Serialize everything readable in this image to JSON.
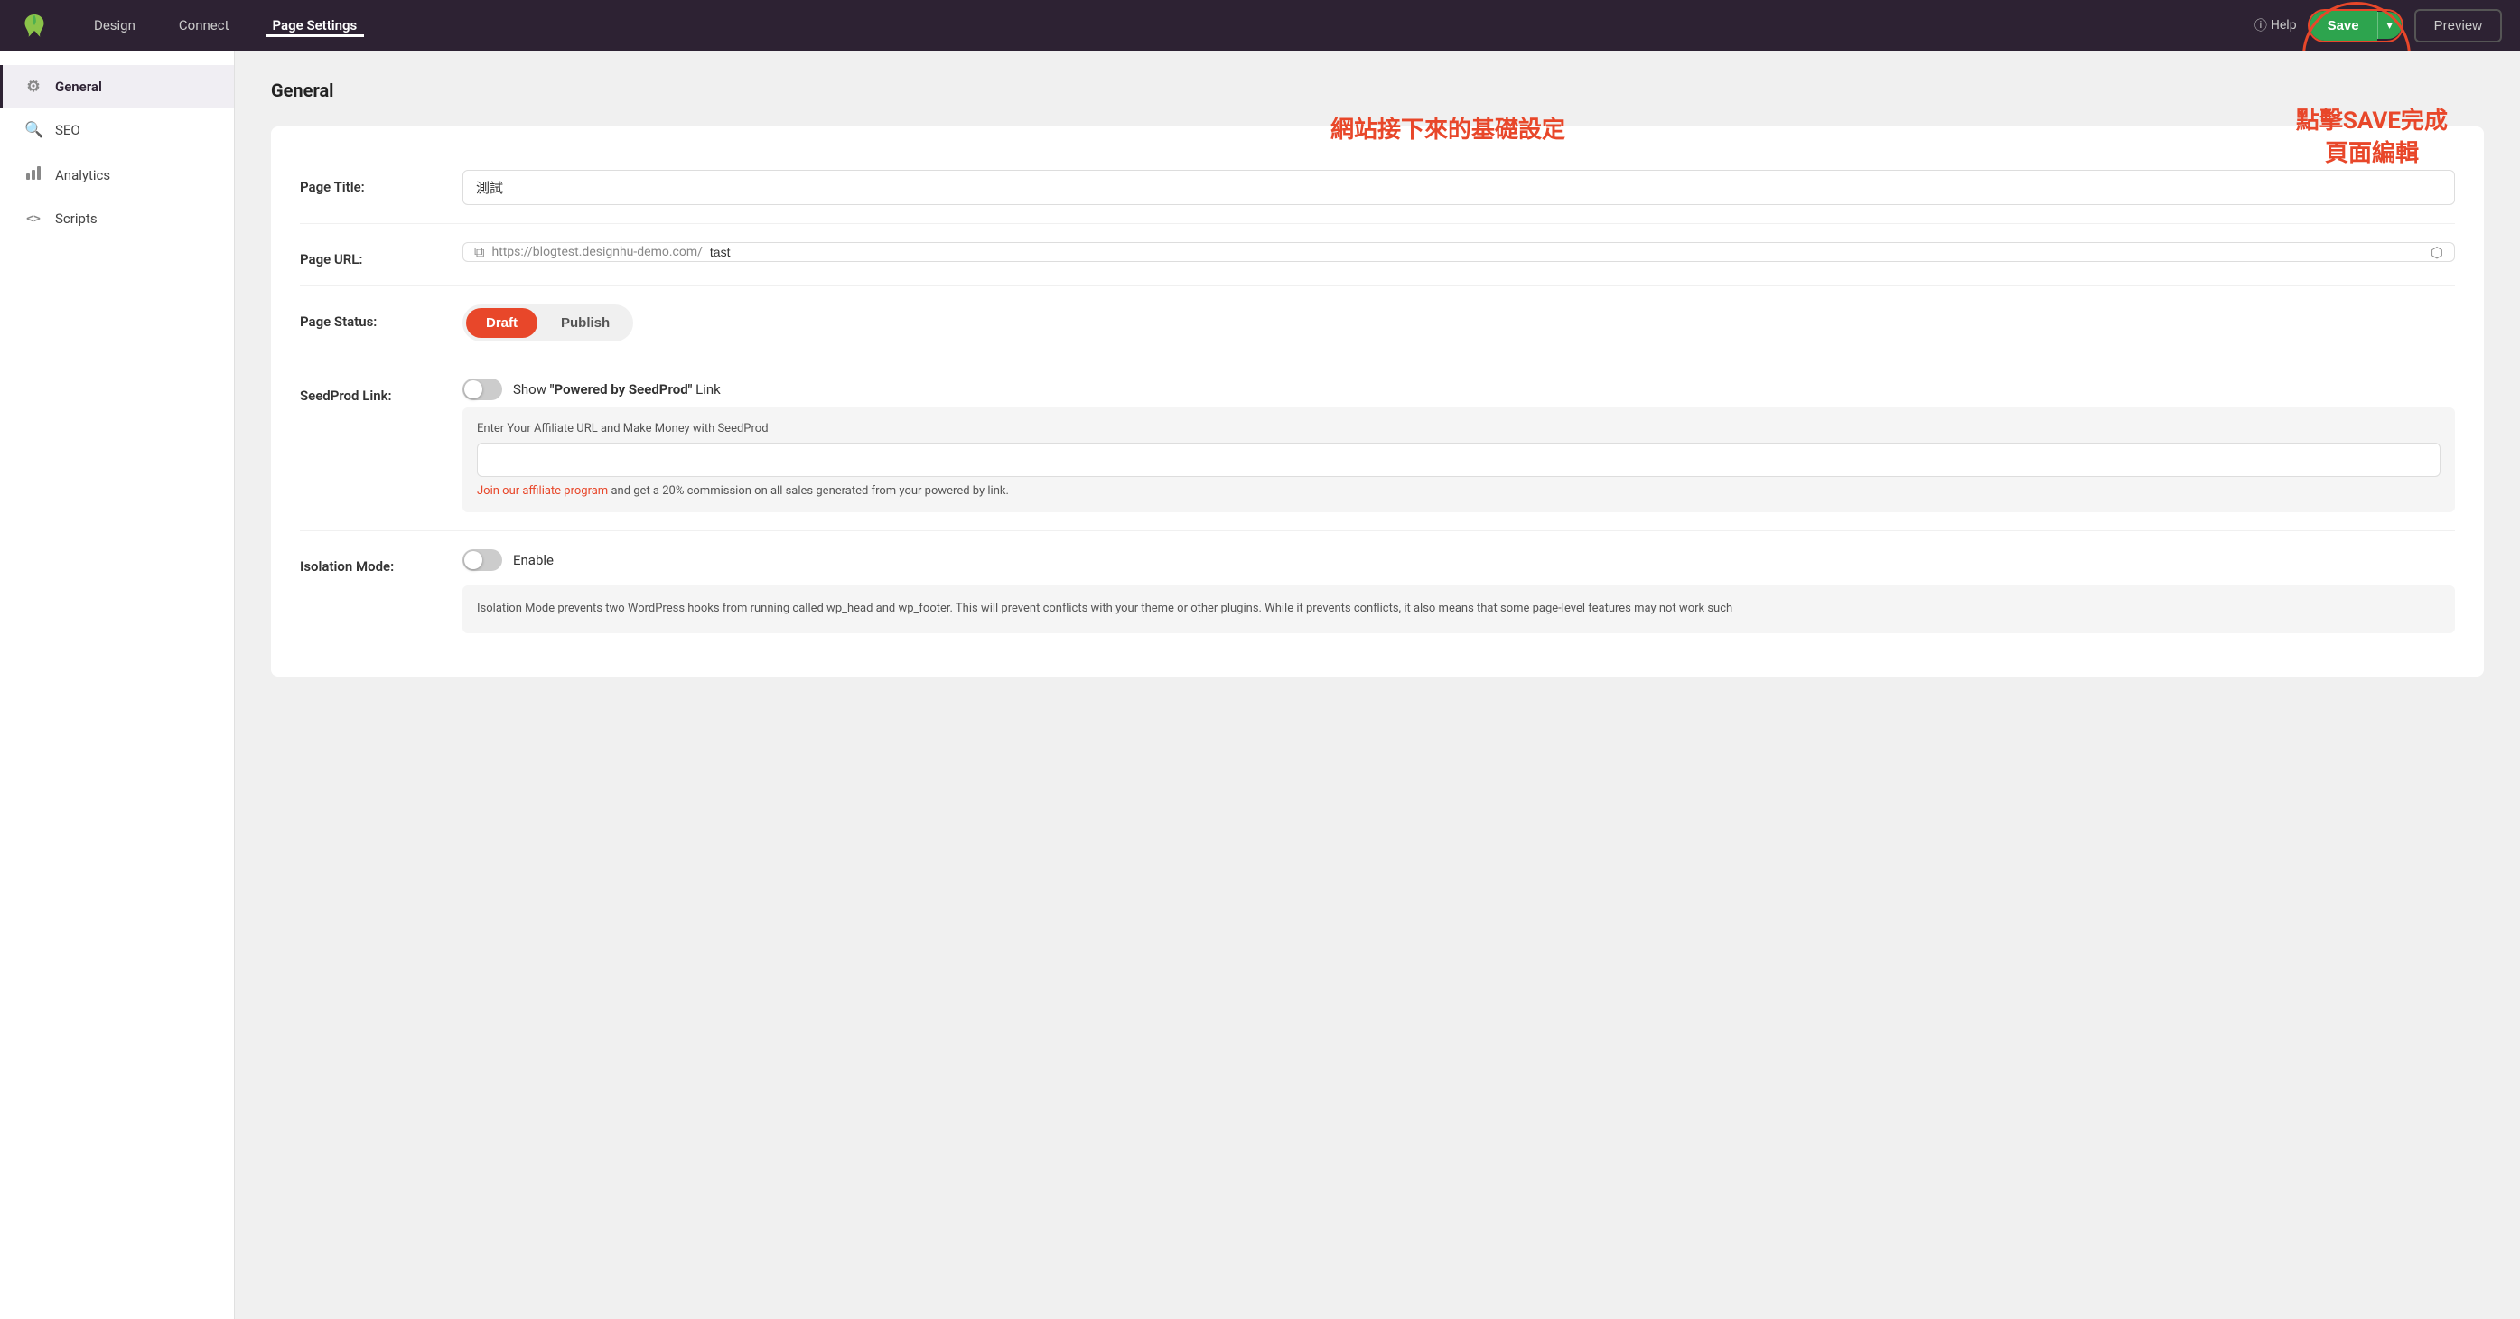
{
  "topnav": {
    "design_label": "Design",
    "connect_label": "Connect",
    "page_settings_label": "Page Settings",
    "help_label": "Help",
    "save_label": "Save",
    "preview_label": "Preview"
  },
  "sidebar": {
    "items": [
      {
        "id": "general",
        "label": "General",
        "icon": "⚙"
      },
      {
        "id": "seo",
        "label": "SEO",
        "icon": "🔍"
      },
      {
        "id": "analytics",
        "label": "Analytics",
        "icon": "📊"
      },
      {
        "id": "scripts",
        "label": "Scripts",
        "icon": "<>"
      }
    ]
  },
  "content": {
    "section_title": "General",
    "annotation_center": "網站接下來的基礎設定",
    "annotation_right": "點擊SAVE完成\n頁面編輯",
    "page_title_label": "Page Title:",
    "page_title_value": "測試",
    "page_url_label": "Page URL:",
    "page_url_base": "https://blogtest.designhu-demo.com/",
    "page_url_slug": "tast",
    "page_status_label": "Page Status:",
    "status_draft": "Draft",
    "status_publish": "Publish",
    "seedprod_link_label": "SeedProd Link:",
    "seedprod_toggle_text_prefix": "Show ",
    "seedprod_toggle_text_bold": "\"Powered by SeedProd\"",
    "seedprod_toggle_text_suffix": " Link",
    "affiliate_desc": "Enter Your Affiliate URL and Make Money with SeedProd",
    "affiliate_link_text": "Join our affiliate program",
    "affiliate_link_suffix": " and get a 20% commission on all sales generated from your powered by link.",
    "isolation_mode_label": "Isolation Mode:",
    "isolation_toggle_text": "Enable",
    "isolation_desc": "Isolation Mode prevents two WordPress hooks from running called wp_head and wp_footer. This will prevent conflicts with your theme or other plugins. While it prevents conflicts, it also means that some page-level features may not work such"
  }
}
